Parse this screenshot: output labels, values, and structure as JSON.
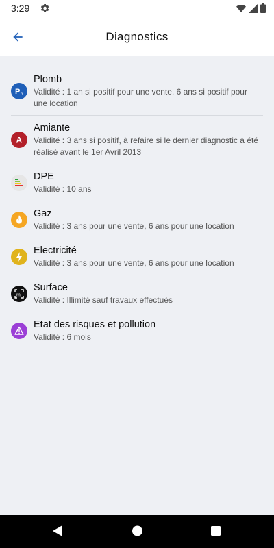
{
  "status": {
    "time": "3:29"
  },
  "header": {
    "title": "Diagnostics"
  },
  "items": [
    {
      "title": "Plomb",
      "subtitle": "Validité : 1 an si positif pour une vente, 6 ans si positif pour une location",
      "icon": "lead-icon",
      "color": "#1f5fb8"
    },
    {
      "title": "Amiante",
      "subtitle": "Validité : 3 ans si positif, à refaire si le dernier diagnostic a été réalisé avant le 1er Avril 2013",
      "icon": "asbestos-icon",
      "color": "#b3202a"
    },
    {
      "title": "DPE",
      "subtitle": "Validité : 10 ans",
      "icon": "energy-label-icon",
      "color": "#e8e8e8"
    },
    {
      "title": "Gaz",
      "subtitle": "Validité : 3 ans pour une vente, 6 ans pour une location",
      "icon": "flame-icon",
      "color": "#f5a623"
    },
    {
      "title": "Electricité",
      "subtitle": "Validité : 3 ans pour une vente, 6 ans pour une location",
      "icon": "lightning-icon",
      "color": "#e0b31c"
    },
    {
      "title": "Surface",
      "subtitle": "Validité : Illimité sauf travaux effectués",
      "icon": "area-measure-icon",
      "color": "#111111"
    },
    {
      "title": "Etat des risques et pollution",
      "subtitle": "Validité : 6 mois",
      "icon": "warning-icon",
      "color": "#9b3fd6"
    }
  ]
}
